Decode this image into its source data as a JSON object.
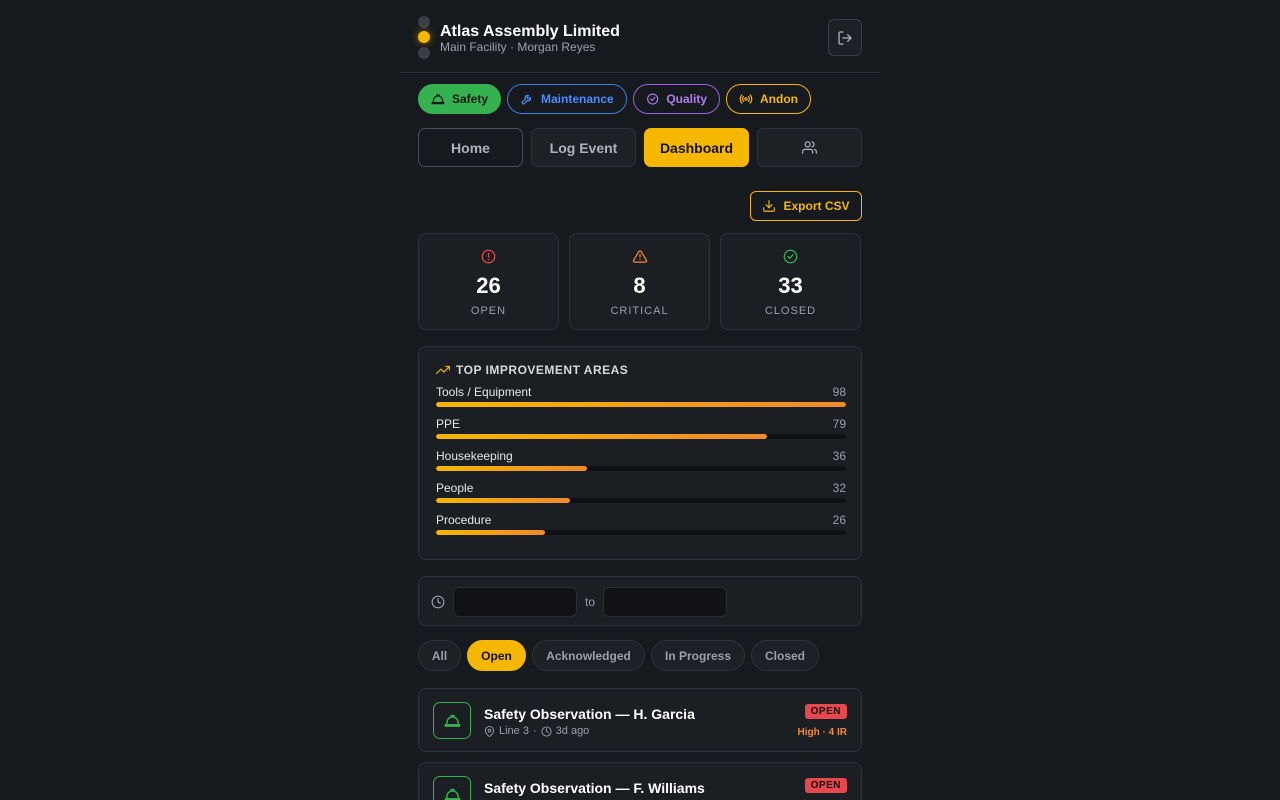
{
  "header": {
    "company": "Atlas Assembly Limited",
    "subline": "Main Facility · Morgan Reyes",
    "logout_icon": "logout-icon"
  },
  "modules": [
    {
      "label": "Safety",
      "icon": "hardhat-icon",
      "color": "#35b24f"
    },
    {
      "label": "Maintenance",
      "icon": "wrench-icon",
      "color": "#4a8dff"
    },
    {
      "label": "Quality",
      "icon": "check-circle-icon",
      "color": "#b07cf0"
    },
    {
      "label": "Andon",
      "icon": "broadcast-icon",
      "color": "#f5b700"
    }
  ],
  "nav": {
    "home": "Home",
    "log_event": "Log Event",
    "dashboard": "Dashboard",
    "users_icon": "users-icon"
  },
  "export": {
    "label": "Export CSV"
  },
  "stats": [
    {
      "value": "26",
      "label": "OPEN",
      "icon": "alert-circle-icon",
      "color": "#e5484d"
    },
    {
      "value": "8",
      "label": "CRITICAL",
      "icon": "warning-triangle-icon",
      "color": "#f08a2c"
    },
    {
      "value": "33",
      "label": "CLOSED",
      "icon": "check-circle-icon",
      "color": "#35b24f"
    }
  ],
  "areas": {
    "title": "TOP IMPROVEMENT AREAS",
    "max": 98,
    "items": [
      {
        "name": "Tools / Equipment",
        "count": 98
      },
      {
        "name": "PPE",
        "count": 79
      },
      {
        "name": "Housekeeping",
        "count": 36
      },
      {
        "name": "People",
        "count": 32
      },
      {
        "name": "Procedure",
        "count": 26
      }
    ]
  },
  "date_filter": {
    "from": "",
    "to_label": "to",
    "to": ""
  },
  "status_filters": [
    "All",
    "Open",
    "Acknowledged",
    "In Progress",
    "Closed"
  ],
  "status_filter_selected": "Open",
  "events": [
    {
      "title": "Safety Observation — H. Garcia",
      "location": "Line 3",
      "time": "3d ago",
      "status": "OPEN",
      "severity": "High · 4 IR"
    },
    {
      "title": "Safety Observation — F. Williams",
      "location": "",
      "time": "",
      "status": "OPEN",
      "severity": ""
    }
  ]
}
